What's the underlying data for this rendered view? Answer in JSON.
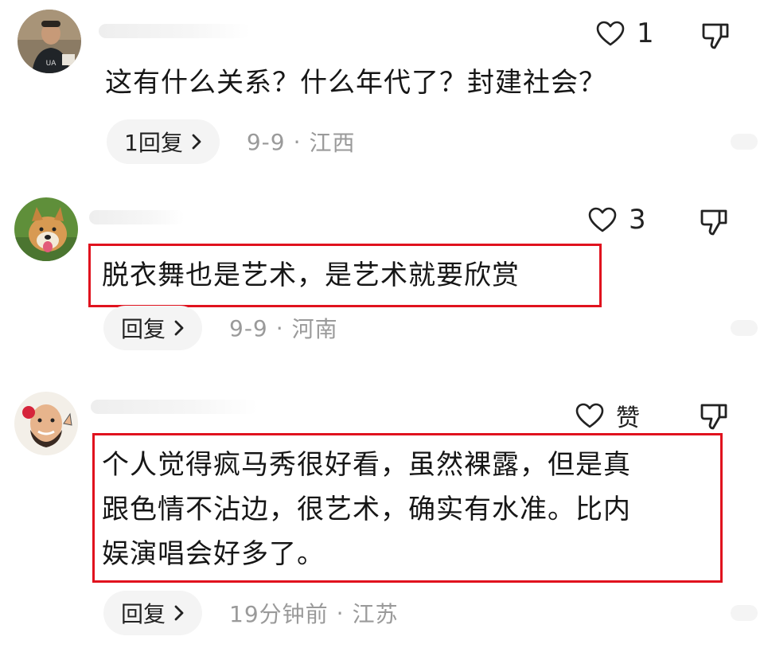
{
  "comments": [
    {
      "id": 1,
      "like_count": "1",
      "text_lines": [
        "这有什么关系？什么年代了？封建社会？"
      ],
      "reply_label": "1回复",
      "date": "9-9",
      "dot": "·",
      "location": "江西",
      "highlighted": false
    },
    {
      "id": 2,
      "like_count": "3",
      "text_lines": [
        "脱衣舞也是艺术，是艺术就要欣赏"
      ],
      "reply_label": "回复",
      "date": "9-9",
      "dot": "·",
      "location": "河南",
      "highlighted": true
    },
    {
      "id": 3,
      "like_count": "赞",
      "text_lines": [
        "个人觉得疯马秀很好看，虽然裸露，但是真",
        "跟色情不沾边，很艺术，确实有水准。比内",
        "娱演唱会好多了。"
      ],
      "reply_label": "回复",
      "date": "19分钟前",
      "dot": "·",
      "location": "江苏",
      "highlighted": true
    }
  ],
  "colors": {
    "highlight_border": "#e0121e",
    "meta_gray": "#9a9a9a",
    "reply_bg": "#f4f4f4"
  },
  "icons": {
    "like": "heart-outline-icon",
    "dislike": "thumbs-down-outline-icon",
    "reply": "chevron-right-icon"
  }
}
